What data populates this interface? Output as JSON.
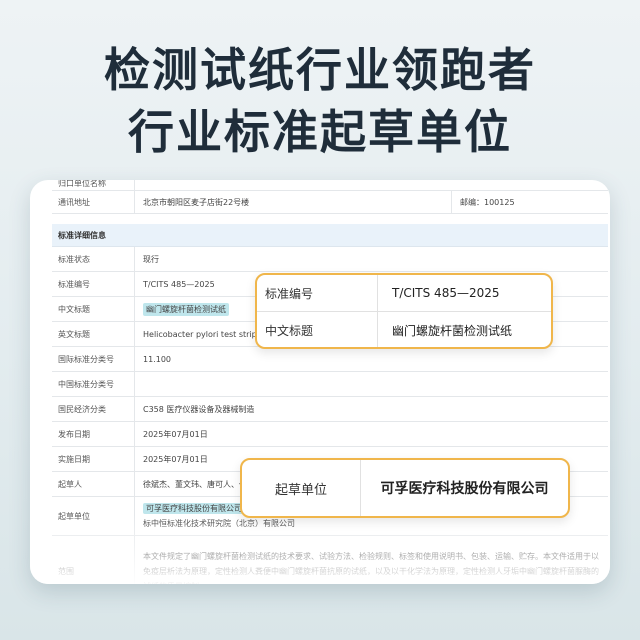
{
  "headline": {
    "line1": "检测试纸行业领跑者",
    "line2": "行业标准起草单位"
  },
  "top_rows": [
    {
      "label": "归口单位名称",
      "value": ""
    },
    {
      "label": "通讯地址",
      "value": "北京市朝阳区麦子店街22号楼",
      "extra": "邮编：100125"
    }
  ],
  "section_title": "标准详细信息",
  "details": [
    {
      "label": "标准状态",
      "value": "现行"
    },
    {
      "label": "标准编号",
      "value": "T/CITS 485—2025"
    },
    {
      "label": "中文标题",
      "value": "幽门螺旋杆菌检测试纸"
    },
    {
      "label": "英文标题",
      "value": "Helicobacter pylori test strips"
    },
    {
      "label": "国际标准分类号",
      "value": "11.100"
    },
    {
      "label": "中国标准分类号",
      "value": ""
    },
    {
      "label": "国民经济分类",
      "value": "C358 医疗仪器设备及器械制造"
    },
    {
      "label": "发布日期",
      "value": "2025年07月01日"
    },
    {
      "label": "实施日期",
      "value": "2025年07月01日"
    },
    {
      "label": "起草人",
      "value": "徐斌杰、董文玮、唐可人、代仕"
    },
    {
      "label": "起草单位",
      "value_highlight": "可孚医疗科技股份有限公司",
      "value_rest": "、杭",
      "value_line2": "标中恒标准化技术研究院（北京）有限公司"
    },
    {
      "label": "范围",
      "value": "本文件规定了幽门螺旋杆菌检测试纸的技术要求、试验方法、检验规则、标签和使用说明书、包装、运输、贮存。本文件适用于以免疫层析法为原理，定性检测人粪便中幽门螺旋杆菌抗原的试纸，以及以干化学法为原理，定性检测人牙垢中幽门螺旋杆菌脲酶的试纸的质量控制。"
    }
  ],
  "callout1": [
    {
      "label": "标准编号",
      "value": "T/CITS 485—2025"
    },
    {
      "label": "中文标题",
      "value": "幽门螺旋杆菌检测试纸"
    }
  ],
  "callout2": {
    "label": "起草单位",
    "value": "可孚医疗科技股份有限公司"
  },
  "colors": {
    "accent": "#f0b64b",
    "highlight": "#bfe6ec",
    "section_bg": "#e9f2fa",
    "headline": "#1f2d3a"
  }
}
